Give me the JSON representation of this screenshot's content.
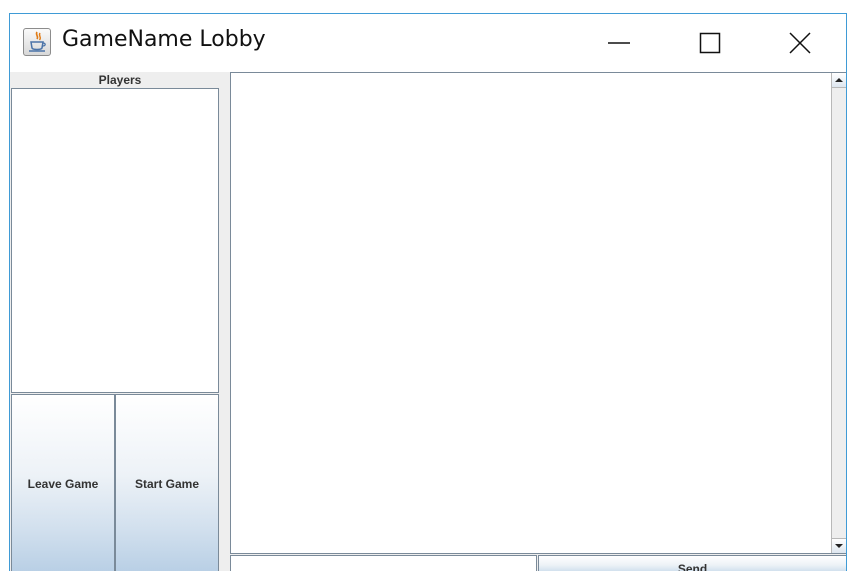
{
  "window": {
    "title": "GameName Lobby",
    "app_icon": "java-coffee-cup-icon",
    "accent_color": "#3f9bd6"
  },
  "players": {
    "header": "Players",
    "items": []
  },
  "buttons": {
    "leave_label": "Leave Game",
    "start_label": "Start Game",
    "send_label": "Send"
  },
  "chat": {
    "messages": [],
    "input_value": ""
  },
  "controls": {
    "minimize_icon": "minimize-icon",
    "maximize_icon": "maximize-icon",
    "close_icon": "close-icon"
  }
}
